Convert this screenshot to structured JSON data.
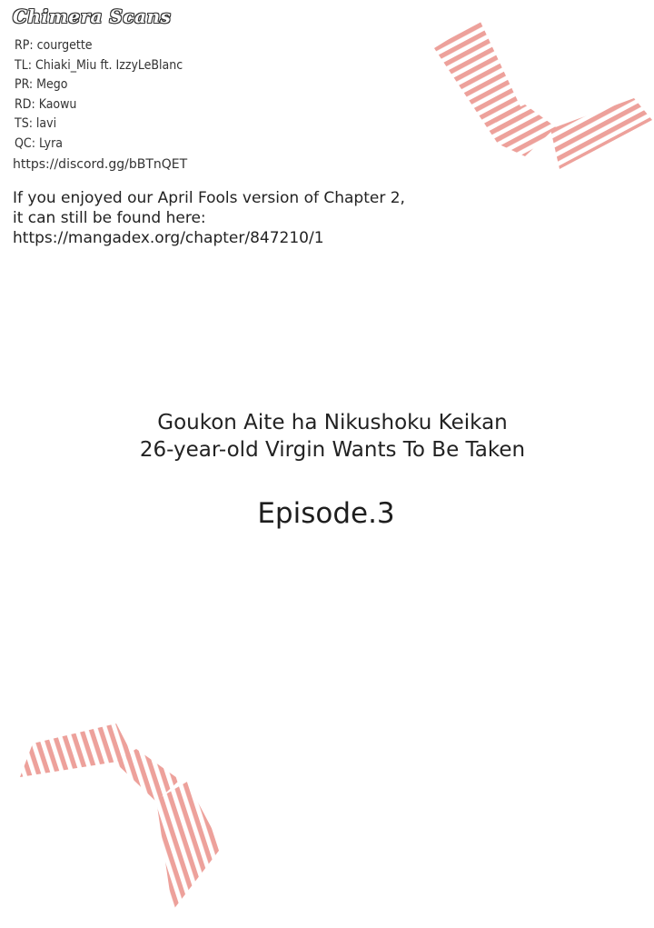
{
  "scan_group": "Chimera Scans",
  "credits": [
    "RP: courgette",
    "TL: Chiaki_Miu ft. IzzyLeBlanc",
    "PR: Mego",
    "RD: Kaowu",
    "TS: lavi",
    "QC: Lyra"
  ],
  "discord_link": "https://discord.gg/bBTnQET",
  "note_lines": [
    "If you enjoyed our April Fools version of Chapter 2,",
    "it can still be found here:",
    "https://mangadex.org/chapter/847210/1"
  ],
  "title_lines": [
    "Goukon Aite ha Nikushoku Keikan",
    "26-year-old Virgin Wants To Be Taken"
  ],
  "episode": "Episode.3",
  "colors": {
    "stripe": "#eda19b",
    "text": "#222222",
    "background": "#ffffff"
  }
}
